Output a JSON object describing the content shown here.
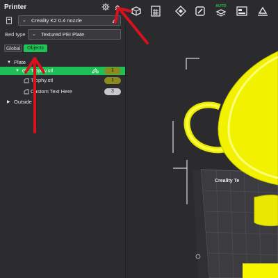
{
  "printer_panel": {
    "title": "Printer",
    "printer_select": "Creality K2 0.4 nozzle",
    "bed_label": "Bed type",
    "bed_select": "Textured PEI Plate"
  },
  "tabs": {
    "global": "Global",
    "objects": "Objects"
  },
  "tree": {
    "plate_label": "Plate",
    "object_name": "Trophy.stl",
    "object_count": "1",
    "part_name": "Trophy.stl",
    "part_count": "1",
    "text_name": "Custom Text Here",
    "text_count": "3",
    "outside_label": "Outside"
  },
  "toolbar": {
    "auto_label": "AUTO"
  },
  "viewport": {
    "plate_label": "Creality Te"
  },
  "colors": {
    "accent_green": "#23c15a",
    "model_yellow": "#f2f200",
    "annotation_red": "#d8111f",
    "panel_bg": "#2c2c30"
  },
  "icons": [
    "gear-icon",
    "collapse-icon",
    "printer-icon",
    "edit-icon",
    "eye-icon",
    "box-icon",
    "grid-icon",
    "orient-icon",
    "arrange-icon",
    "auto-arrange-icon",
    "split-icon",
    "erase-icon"
  ]
}
